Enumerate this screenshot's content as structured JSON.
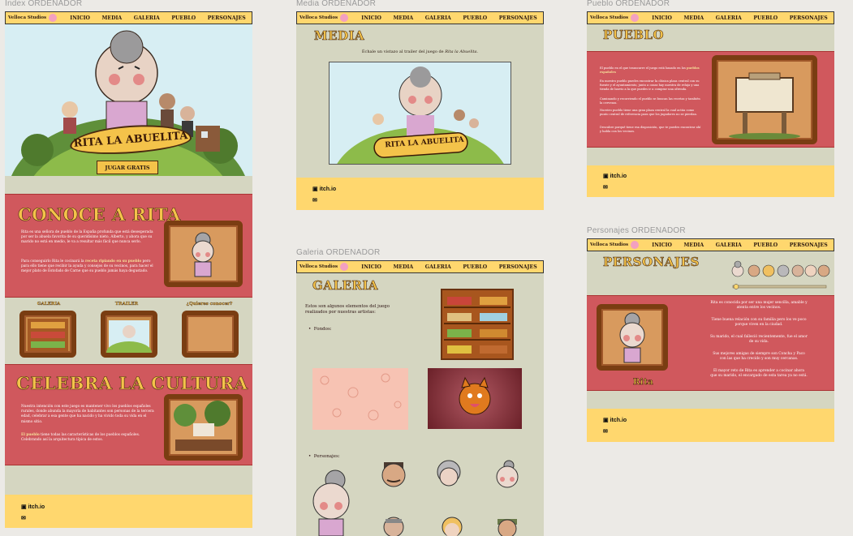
{
  "labels": {
    "index": "Index ORDENADOR",
    "media": "Media ORDENADOR",
    "pueblo": "Pueblo ORDENADOR",
    "galeria": "Galeria ORDENADOR",
    "personajes": "Personajes ORDENADOR"
  },
  "nav": {
    "brand": "Velloca Studios",
    "items": [
      "INICIO",
      "MEDIA",
      "GALERIA",
      "PUEBLO",
      "PERSONAJES"
    ]
  },
  "index": {
    "game_title": "RITA LA ABUELITA",
    "play_button": "JUGAR GRATIS",
    "conoce_title": "CONOCE A RITA",
    "conoce_p1": "Rita es una señora de pueblo de la España profunda que está desesperada por ser la abuela favorita de su queridísimo nieto, Alberto, y ahora que su marido no está en medio, le va a resultar más fácil que nunca serlo.",
    "conoce_p2_a": "Para conseguirlo Rita le cocinará la ",
    "conoce_p2_link": "receta ripiando en su pueblo",
    "conoce_p2_b": " pero para ello tiene que recibir la ayuda y consejos de su vecinos, para hacer el mejor plato de Estofado de Carne que su pueblo jamás haya degustado.",
    "minis": [
      "GALERIA",
      "TRAILER",
      "¿Quieres conocer?"
    ],
    "cultura_title": "CELEBRA LA CULTURA",
    "cultura_p1": "Nuestra intención con este juego es mantener vivo los pueblos españoles rurales, donde abunda la mayoría de habitantes son personas de la tercera edad, celebrar a esa gente que ha nacido y ha vivido toda su vida en el mismo sitio.",
    "cultura_p2_link": "El pueblo",
    "cultura_p2": " tiene todas las características de los pueblos españoles. Celebrando así la arquitectura típica de estos."
  },
  "footer": {
    "itch": "itch.io",
    "mail_icon": "mail-icon"
  },
  "media": {
    "title": "MEDIA",
    "intro_a": "Échale un vistazo al trailer del juego de ",
    "intro_b": "Rita la Abuelita."
  },
  "galeria": {
    "title": "GALERIA",
    "intro": "Estos son algunos elementos del juego realizados por nuestras artistas:",
    "fondos": "Fondos:",
    "personajes": "Personajes:"
  },
  "pueblo": {
    "title": "PUEBLO",
    "p1_a": "El pueblo en el que transcurre el juego está basado en los ",
    "p1_link": "pueblos españoles",
    "p2": "En nuestro pueblo puedes encontrar la clásica plaza central con su fuente y el ayuntamiento, junto a casas hay nuestra de relaja y una tienda de barrio a la que puedes ir a comprar una ofrenda.",
    "p3": "Caminando y recorriendo el pueblo se buscan las recetas y también la cervezas.",
    "p4": "Nuestro pueblo tiene una gran plaza central la cual actúa como punto central de referencia para que los jugadores no se pierdan.",
    "p5": "Descubre porqué tiene esa disposición, que te puedes encontrar ahí y habla con los vecinos."
  },
  "personajes": {
    "title": "PERSONAJES",
    "name": "Rita",
    "p1": "Rita es conocida por ser una mujer sencilla, amable y atenta entre los vecinos.",
    "p2": "Tiene buena relación con su familia pero los ve poco porque viven en la ciudad.",
    "p3": "Su marido, el cual falleció recientemente, fue el amor de su vida.",
    "p4": "Sus mejores amigas de siempre son Concha y Paco con las que ha crecido y son muy cercanas.",
    "p5": "El mayor reto de Rita es aprender a cocinar ahora que su marido, el encargado de esta tarea ya no está."
  },
  "colors": {
    "nav_yellow": "#ffd76e",
    "sage": "#d5d6c1",
    "red": "#d0585d",
    "gold_title": "#f4c34a",
    "frame_brown": "#7a3d12"
  }
}
